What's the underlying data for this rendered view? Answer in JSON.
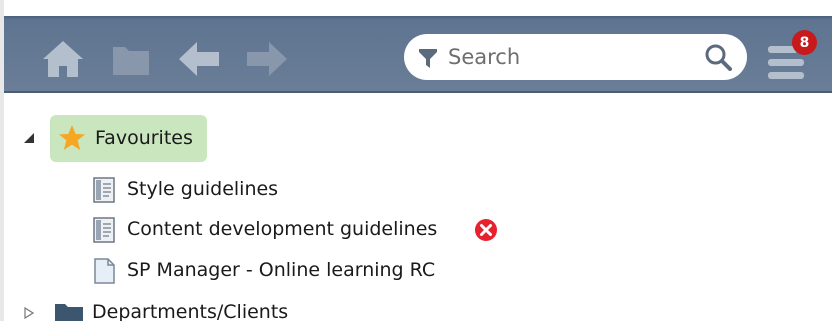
{
  "toolbar": {
    "home": {
      "icon": "home-icon"
    },
    "folder": {
      "icon": "folder-icon"
    },
    "back": {
      "icon": "arrow-left-icon"
    },
    "forward": {
      "icon": "arrow-right-icon"
    },
    "search": {
      "placeholder": "Search",
      "value": "",
      "filter_icon": "filter-icon",
      "search_icon": "search-icon"
    },
    "menu": {
      "icon": "hamburger-menu-icon",
      "badge_count": "8"
    },
    "colors": {
      "bar": "#6a7e98",
      "icons": "#b4bfcd",
      "badge": "#c8191b"
    }
  },
  "tree": {
    "favourites": {
      "label": "Favourites",
      "icon": "star-icon",
      "expanded": true,
      "highlight": "#c9e6be",
      "items": [
        {
          "label": "Style guidelines",
          "icon": "document-icon",
          "error": false
        },
        {
          "label": "Content development guidelines",
          "icon": "document-icon",
          "error": true
        },
        {
          "label": "SP Manager - Online learning RC",
          "icon": "page-icon",
          "error": false
        }
      ]
    },
    "departments": {
      "label": "Departments/Clients",
      "icon": "folder-icon",
      "expanded": false
    }
  }
}
